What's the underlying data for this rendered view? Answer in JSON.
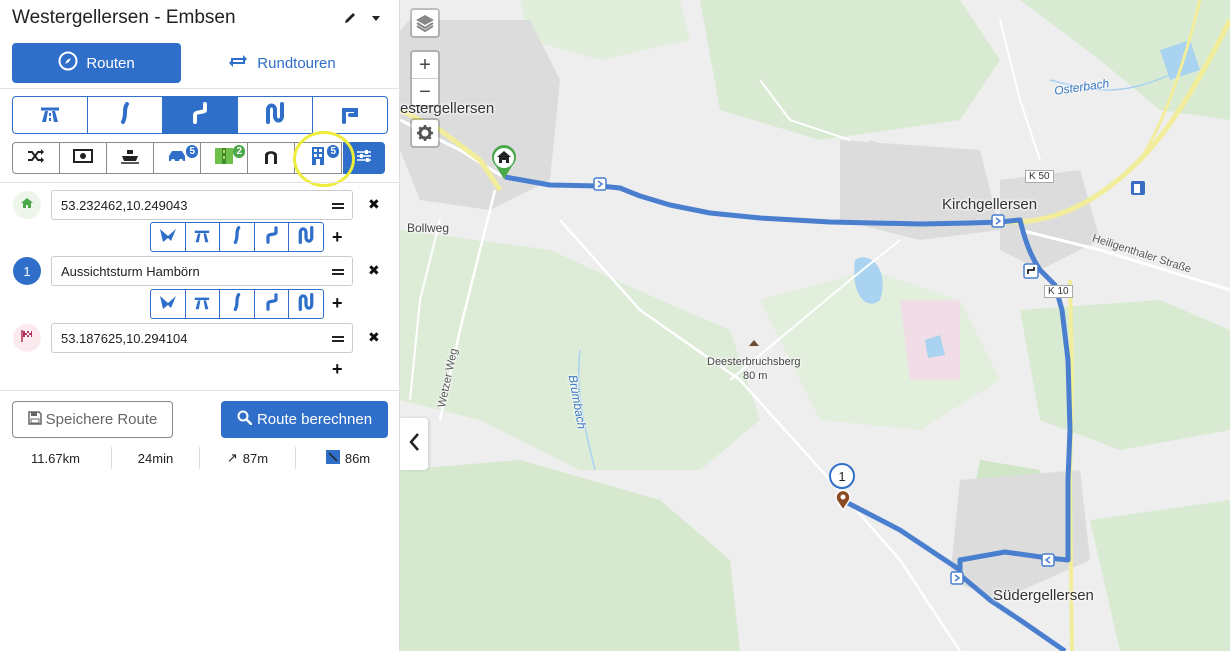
{
  "sidebar": {
    "title": "Westergellersen - Embsen",
    "mode_tabs": [
      {
        "label": "Routen",
        "active": true,
        "icon": "compass-icon"
      },
      {
        "label": "Rundtouren",
        "active": false,
        "icon": "loop-arrows-icon"
      }
    ],
    "road_types": [
      {
        "icon": "highway-icon",
        "active": false
      },
      {
        "icon": "gentle-curve-icon",
        "active": false
      },
      {
        "icon": "curvy-road-icon",
        "active": true
      },
      {
        "icon": "very-curvy-road-icon",
        "active": false
      },
      {
        "icon": "hairpin-road-icon",
        "active": false
      }
    ],
    "avoid_options": [
      {
        "icon": "shuffle-icon",
        "badge": ""
      },
      {
        "icon": "money-toll-icon",
        "badge": ""
      },
      {
        "icon": "ferry-icon",
        "badge": ""
      },
      {
        "icon": "car-icon",
        "badge": "5"
      },
      {
        "icon": "dirt-road-icon",
        "badge": "2"
      },
      {
        "icon": "tunnel-icon",
        "badge": ""
      },
      {
        "icon": "city-building-icon",
        "badge": "5"
      }
    ],
    "waypoints": [
      {
        "marker": "home-icon",
        "marker_text": "",
        "value": "53.232462,10.249043"
      },
      {
        "marker": "number-marker",
        "marker_text": "1",
        "value": "Aussichtsturm Hambörn"
      },
      {
        "marker": "finish-flag-icon",
        "marker_text": "",
        "value": "53.187625,10.294104"
      }
    ],
    "segment_options": [
      "swallow-icon",
      "highway-icon",
      "gentle-curve-icon",
      "curvy-road-icon",
      "very-curvy-road-icon"
    ],
    "save_label": "Speichere Route",
    "calc_label": "Route berechnen",
    "stats": {
      "distance": "11.67km",
      "duration": "24min",
      "ascent": "87m",
      "descent": "86m"
    }
  },
  "map": {
    "places": {
      "westergellersen": "estergellersen",
      "kirchgellersen": "Kirchgellersen",
      "suedergellersen": "Südergellersen",
      "bollweg": "Bollweg",
      "deesterbruchsberg": "Deesterbruchsberg",
      "deesterbruchsberg_elev": "80 m"
    },
    "waters": {
      "osterbach": "Osterbach",
      "bruembach": "Brümbach"
    },
    "roads": {
      "wetzer_weg": "Wetzer Weg",
      "heiligenthaler": "Heiligenthaler Straße",
      "k50": "K 50",
      "k10": "K 10"
    },
    "waypoint_number": "1",
    "colors": {
      "route": "#4a7fd0",
      "forest": "#d6ead0",
      "residential": "#dcdcdc",
      "water": "#aad3f1",
      "major_road": "#f5f2a0",
      "accent": "#2f6fc9"
    }
  }
}
